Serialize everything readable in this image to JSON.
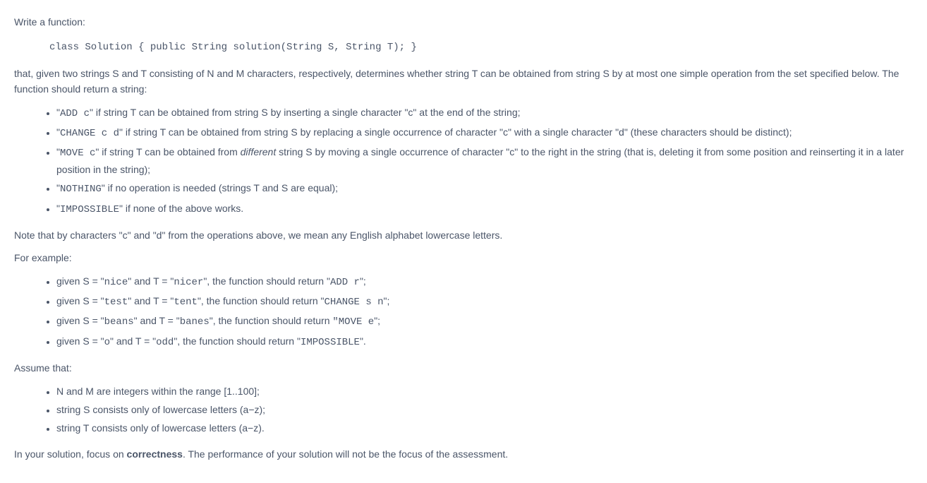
{
  "intro": "Write a function:",
  "code": "class Solution { public String solution(String S, String T); }",
  "description": "that, given two strings S and T consisting of N and M characters, respectively, determines whether string T can be obtained from string S by at most one simple operation from the set specified below. The function should return a string:",
  "ops": {
    "add_prefix": "\"",
    "add_code": "ADD c",
    "add_suffix": "\" if string T can be obtained from string S by inserting a single character \"c\" at the end of the string;",
    "change_code": "CHANGE c d",
    "change_suffix": "\" if string T can be obtained from string S by replacing a single occurrence of character \"c\" with a single character \"d\" (these characters should be distinct);",
    "move_code": "MOVE c",
    "move_text1": "\" if string T can be obtained from ",
    "move_italic": "different",
    "move_text2": " string S by moving a single occurrence of character \"c\" to the right in the string (that is, deleting it from some position and reinserting it in a later position in the string);",
    "nothing_code": "NOTHING",
    "nothing_suffix": "\" if no operation is needed (strings T and S are equal);",
    "impossible_code": "IMPOSSIBLE",
    "impossible_suffix": "\" if none of the above works."
  },
  "note": "Note that by characters \"c\" and \"d\" from the operations above, we mean any English alphabet lowercase letters.",
  "example_intro": "For example:",
  "examples": {
    "ex1_p1": "given S = \"",
    "ex1_s": "nice",
    "ex1_p2": "\" and T = \"",
    "ex1_t": "nicer",
    "ex1_p3": "\", the function should return \"",
    "ex1_r": "ADD r",
    "ex1_p4": "\";",
    "ex2_p1": "given S = \"",
    "ex2_s": "test",
    "ex2_p2": "\" and T = \"",
    "ex2_t": "tent",
    "ex2_p3": "\", the function should return \"",
    "ex2_r": "CHANGE s n",
    "ex2_p4": "\";",
    "ex3_p1": "given S = \"",
    "ex3_s": "beans",
    "ex3_p2": "\" and T = \"",
    "ex3_t": "banes",
    "ex3_p3": "\", the function should return ",
    "ex3_r": "\"MOVE e",
    "ex3_p4": "\";",
    "ex4_p1": "given S = \"",
    "ex4_s": "o",
    "ex4_p2": "\" and T = \"",
    "ex4_t": "odd",
    "ex4_p3": "\", the function should return \"",
    "ex4_r": "IMPOSSIBLE",
    "ex4_p4": "\"."
  },
  "assume_intro": "Assume that:",
  "assumptions": {
    "a1": "N and M are integers within the range [1..100];",
    "a2": "string S consists only of lowercase letters (a−z);",
    "a3": "string T consists only of lowercase letters (a−z)."
  },
  "footer": {
    "p1": "In your solution, focus on ",
    "bold": "correctness",
    "p2": ". The performance of your solution will not be the focus of the assessment."
  }
}
